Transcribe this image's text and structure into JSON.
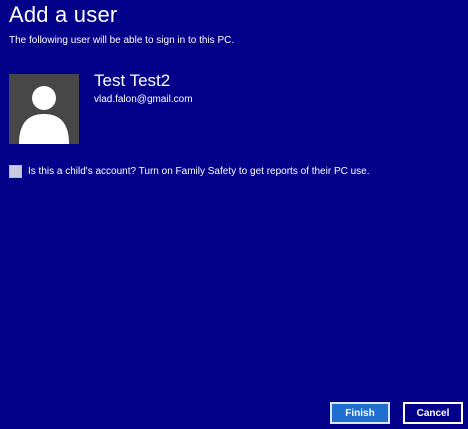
{
  "window": {
    "title": "Add a user",
    "subtitle": "The following user will be able to sign in to this PC."
  },
  "user": {
    "avatar_icon": "user-silhouette-icon",
    "name": "Test Test2",
    "email": "vlad.falon@gmail.com"
  },
  "family_safety": {
    "checked": false,
    "label": "Is this a child's account? Turn on Family Safety to get reports of their PC use."
  },
  "buttons": {
    "finish_label": "Finish",
    "cancel_label": "Cancel"
  },
  "colors": {
    "background": "#03008a",
    "finish_button": "#1f6fd0",
    "avatar_background": "#474747"
  }
}
